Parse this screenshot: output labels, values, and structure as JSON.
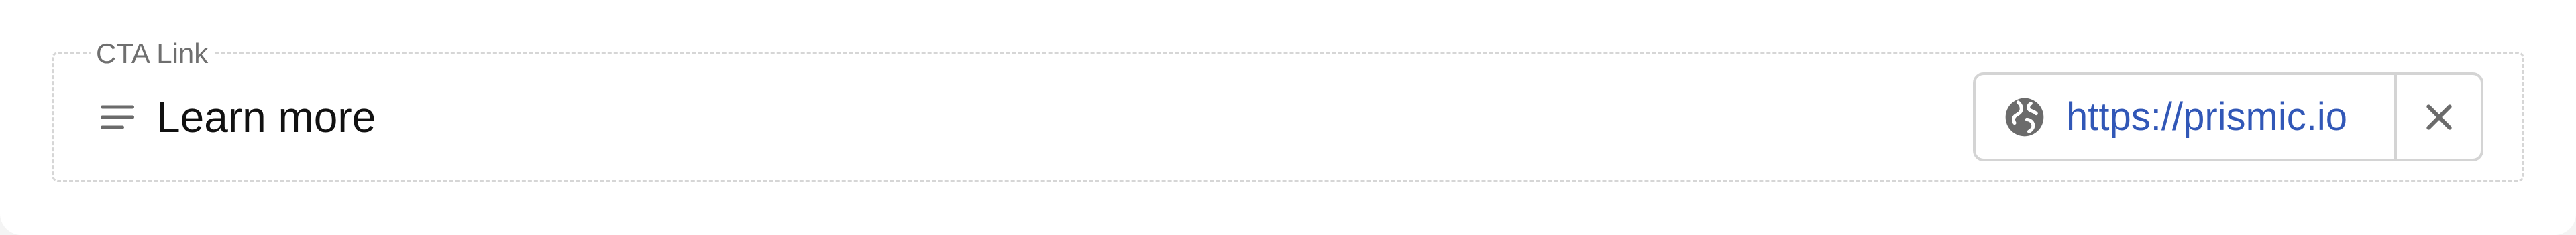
{
  "field": {
    "legend": "CTA Link",
    "link_text": "Learn more",
    "url": "https://prismic.io"
  },
  "icons": {
    "menu": "menu-icon",
    "globe": "globe-icon",
    "close": "close-icon"
  },
  "colors": {
    "panel_background": "#ffffff",
    "page_background": "#f4f4f4",
    "dashed_border": "#d6d6d6",
    "chip_border": "#d4d4d4",
    "legend_text": "#6f6f6f",
    "link_text": "#111111",
    "url_text": "#3157b7",
    "icon_gray": "#6b6b6b"
  }
}
